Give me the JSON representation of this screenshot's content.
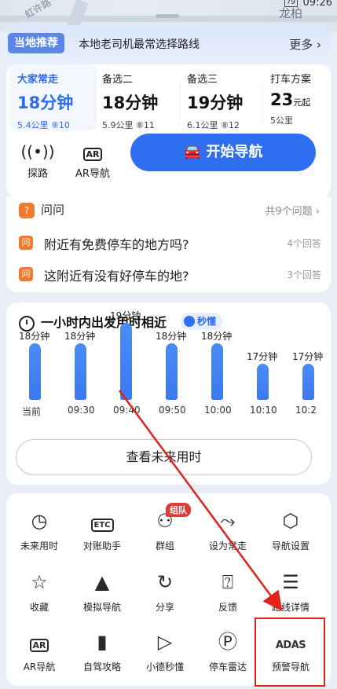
{
  "status": {
    "time": "09:26",
    "battery": "79"
  },
  "map": {
    "place": "龙柏",
    "street": "虹许路"
  },
  "local_tag": "当地推荐",
  "local_desc": "本地老司机最常选择路线",
  "more_label": "更多",
  "routes": [
    {
      "name": "大家常走",
      "time": "18分钟",
      "unit": "",
      "info": "5.4公里 ⑧10"
    },
    {
      "name": "备选二",
      "time": "18分钟",
      "unit": "",
      "info": "5.9公里 ⑧11"
    },
    {
      "name": "备选三",
      "time": "19分钟",
      "unit": "",
      "info": "6.1公里 ⑧12"
    },
    {
      "name": "打车方案",
      "time": "23",
      "unit": "元起",
      "info": "5公里"
    }
  ],
  "tools": [
    {
      "label": "探路",
      "icon": "signal-icon"
    },
    {
      "label": "AR导航",
      "icon": "ar-icon"
    }
  ],
  "start_nav_label": "开始导航",
  "ask": {
    "title": "问问",
    "count": "共9个问题",
    "questions": [
      {
        "text": "附近有免费停车的地方吗?",
        "answers": "4个回答"
      },
      {
        "text": "这附近有没有好停车的地?",
        "answers": "3个回答"
      }
    ]
  },
  "time_section": {
    "title": "一小时内出发用时相近",
    "badge": "秒懂",
    "future_label": "查看未来用时"
  },
  "chart_data": {
    "type": "bar",
    "categories": [
      "当前",
      "09:30",
      "09:40",
      "09:50",
      "10:00",
      "10:10",
      "10:2"
    ],
    "values": [
      18,
      18,
      19,
      18,
      18,
      17,
      17
    ],
    "labels": [
      "18分钟",
      "18分钟",
      "19分钟",
      "18分钟",
      "18分钟",
      "17分钟",
      "17分钟"
    ],
    "unit": "分钟"
  },
  "grid": [
    {
      "label": "未来用时",
      "icon": "clock-icon"
    },
    {
      "label": "对账助手",
      "icon": "etc-icon"
    },
    {
      "label": "群组",
      "icon": "group-icon",
      "badge": "组队"
    },
    {
      "label": "设为常走",
      "icon": "route-icon"
    },
    {
      "label": "导航设置",
      "icon": "settings-icon"
    },
    {
      "label": "收藏",
      "icon": "star-icon"
    },
    {
      "label": "模拟导航",
      "icon": "navigate-icon"
    },
    {
      "label": "分享",
      "icon": "share-icon"
    },
    {
      "label": "反馈",
      "icon": "feedback-icon"
    },
    {
      "label": "路线详情",
      "icon": "list-icon"
    },
    {
      "label": "AR导航",
      "icon": "ar-icon"
    },
    {
      "label": "自驾攻略",
      "icon": "book-icon"
    },
    {
      "label": "小德秒懂",
      "icon": "play-icon"
    },
    {
      "label": "停车雷达",
      "icon": "parking-icon"
    },
    {
      "label": "预警导航",
      "icon": "adas-icon",
      "icon_text": "ADAS"
    }
  ],
  "colors": {
    "accent": "#2e6ef0",
    "highlight": "#e0241c",
    "tag": "#5a86e6",
    "warning": "#f07a2d"
  }
}
